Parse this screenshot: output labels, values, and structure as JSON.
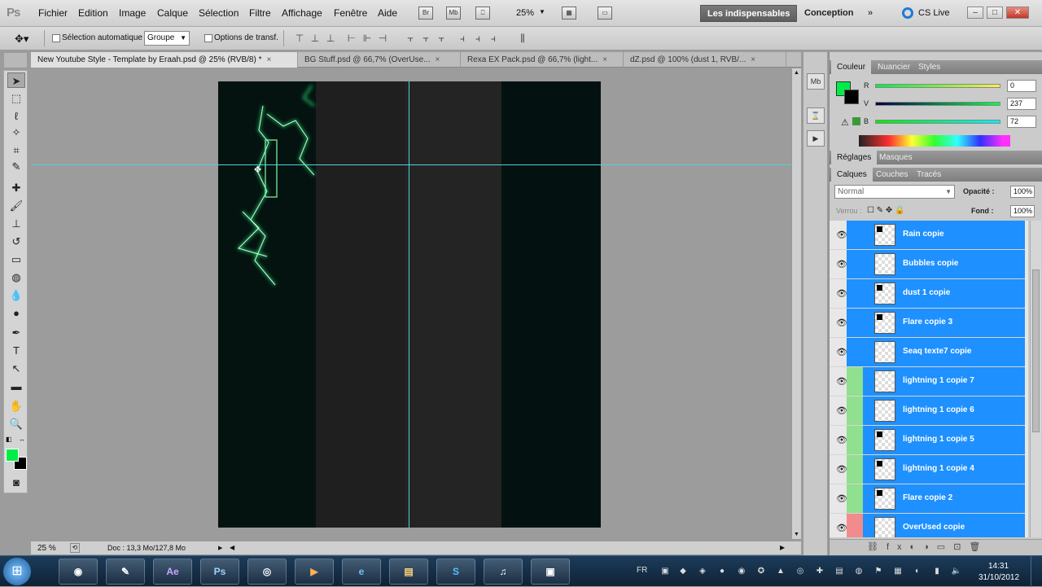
{
  "app": {
    "logo": "Ps"
  },
  "menu": [
    "Fichier",
    "Edition",
    "Image",
    "Calque",
    "Sélection",
    "Filtre",
    "Affichage",
    "Fenêtre",
    "Aide"
  ],
  "menubar_icons": [
    "Br",
    "Mb",
    "⎕",
    "25%"
  ],
  "workspace": {
    "essentials": "Les indispensables",
    "design": "Conception",
    "more": "»",
    "cslive": "CS Live"
  },
  "window_buttons": [
    "–",
    "□",
    "✕"
  ],
  "options": {
    "auto_select": "Sélection automatique :",
    "group_value": "Groupe",
    "transform": "Options de transf."
  },
  "tabs": [
    {
      "label": "New Youtube Style - Template by Eraah.psd @ 25% (RVB/8) *",
      "close": "×"
    },
    {
      "label": "BG Stuff.psd @ 66,7% (OverUse...",
      "close": "×"
    },
    {
      "label": "Rexa EX Pack.psd @ 66,7% (light...",
      "close": "×"
    },
    {
      "label": "dZ.psd @ 100% (dust 1, RVB/...",
      "close": "×"
    }
  ],
  "status": {
    "zoom": "25 %",
    "doc": "Doc : 13,3 Mo/127,8 Mo"
  },
  "color_panel": {
    "tabs": [
      "Couleur",
      "Nuancier",
      "Styles"
    ],
    "channels": [
      {
        "label": "R",
        "value": "0"
      },
      {
        "label": "V",
        "value": "237"
      },
      {
        "label": "B",
        "value": "72"
      }
    ],
    "foreground": "#00ED48"
  },
  "adjust_panel": {
    "tabs": [
      "Réglages",
      "Masques"
    ]
  },
  "layers_panel": {
    "tabs": [
      "Calques",
      "Couches",
      "Tracés"
    ],
    "blend_mode": "Normal",
    "opacity_label": "Opacité :",
    "opacity": "100%",
    "lock_label": "Verrou :",
    "fill_label": "Fond :",
    "fill": "100%",
    "layers": [
      {
        "name": "Rain copie",
        "color": "#1e90ff"
      },
      {
        "name": "Bubbles copie",
        "color": "#1e90ff"
      },
      {
        "name": "dust 1 copie",
        "color": "#1e90ff"
      },
      {
        "name": "Flare copie 3",
        "color": "#1e90ff"
      },
      {
        "name": "Seaq texte7 copie",
        "color": "#1e90ff"
      },
      {
        "name": "lightning 1 copie 7",
        "color": "#8fe08f"
      },
      {
        "name": "lightning 1 copie 6",
        "color": "#8fe08f"
      },
      {
        "name": "lightning 1 copie 5",
        "color": "#8fe08f"
      },
      {
        "name": "lightning 1 copie 4",
        "color": "#8fe08f"
      },
      {
        "name": "Flare copie 2",
        "color": "#8fe08f"
      },
      {
        "name": "OverUsed copie",
        "color": "#f28b8b"
      }
    ]
  },
  "taskbar": {
    "apps": [
      "⊞",
      "◉",
      "✎",
      "Ae",
      "Ps",
      "◎",
      "▶",
      "e",
      "▤",
      "S",
      "♫",
      "▣"
    ],
    "lang": "FR",
    "time": "14:31",
    "date": "31/10/2012"
  }
}
